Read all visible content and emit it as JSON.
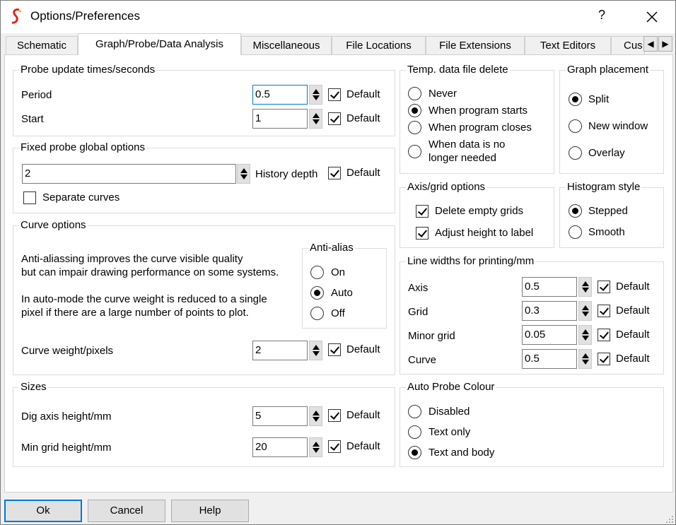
{
  "window": {
    "title": "Options/Preferences",
    "help_glyph": "?",
    "accent": "#0078d7"
  },
  "tabs": [
    {
      "label": "Schematic",
      "active": false
    },
    {
      "label": "Graph/Probe/Data Analysis",
      "active": true
    },
    {
      "label": "Miscellaneous",
      "active": false
    },
    {
      "label": "File Locations",
      "active": false
    },
    {
      "label": "File Extensions",
      "active": false
    },
    {
      "label": "Text Editors",
      "active": false
    },
    {
      "label": "Cus",
      "active": false
    }
  ],
  "tab_scroll": {
    "left_icon": "◀",
    "right_icon": "▶"
  },
  "probe_update": {
    "title": "Probe update times/seconds",
    "period_label": "Period",
    "period_value": "0.5",
    "start_label": "Start",
    "start_value": "1",
    "default_label": "Default"
  },
  "fixed_probe": {
    "title": "Fixed probe global options",
    "history_value": "2",
    "history_label": "History depth",
    "default_label": "Default",
    "separate_label": "Separate curves"
  },
  "curve_options": {
    "title": "Curve options",
    "desc1": "Anti-aliassing improves the curve visible quality",
    "desc2": "but can impair drawing performance on some systems.",
    "desc3": "In auto-mode the curve weight is reduced to a single",
    "desc4": "pixel if there are a large number of points to plot.",
    "antialias_title": "Anti-alias",
    "antialias_options": [
      "On",
      "Auto",
      "Off"
    ],
    "antialias_selected": "Auto",
    "weight_label": "Curve weight/pixels",
    "weight_value": "2",
    "default_label": "Default"
  },
  "sizes": {
    "title": "Sizes",
    "dig_label": "Dig axis height/mm",
    "dig_value": "5",
    "grid_label": "Min grid height/mm",
    "grid_value": "20",
    "default_label": "Default"
  },
  "temp_delete": {
    "title": "Temp. data file delete",
    "options": [
      "Never",
      "When program starts",
      "When program closes",
      "When data is no",
      "longer needed"
    ],
    "selected": "When program starts"
  },
  "graph_placement": {
    "title": "Graph placement",
    "options": [
      "Split",
      "New window",
      "Overlay"
    ],
    "selected": "Split"
  },
  "axis_grid": {
    "title": "Axis/grid options",
    "delete_label": "Delete empty grids",
    "adjust_label": "Adjust height to label"
  },
  "histogram": {
    "title": "Histogram style",
    "options": [
      "Stepped",
      "Smooth"
    ],
    "selected": "Stepped"
  },
  "line_widths": {
    "title": "Line widths for printing/mm",
    "rows": [
      {
        "label": "Axis",
        "value": "0.5"
      },
      {
        "label": "Grid",
        "value": "0.3"
      },
      {
        "label": "Minor grid",
        "value": "0.05"
      },
      {
        "label": "Curve",
        "value": "0.5"
      }
    ],
    "default_label": "Default"
  },
  "auto_probe": {
    "title": "Auto Probe Colour",
    "options": [
      "Disabled",
      "Text only",
      "Text and body"
    ],
    "selected": "Text and body"
  },
  "buttons": {
    "ok": "Ok",
    "cancel": "Cancel",
    "help": "Help"
  }
}
